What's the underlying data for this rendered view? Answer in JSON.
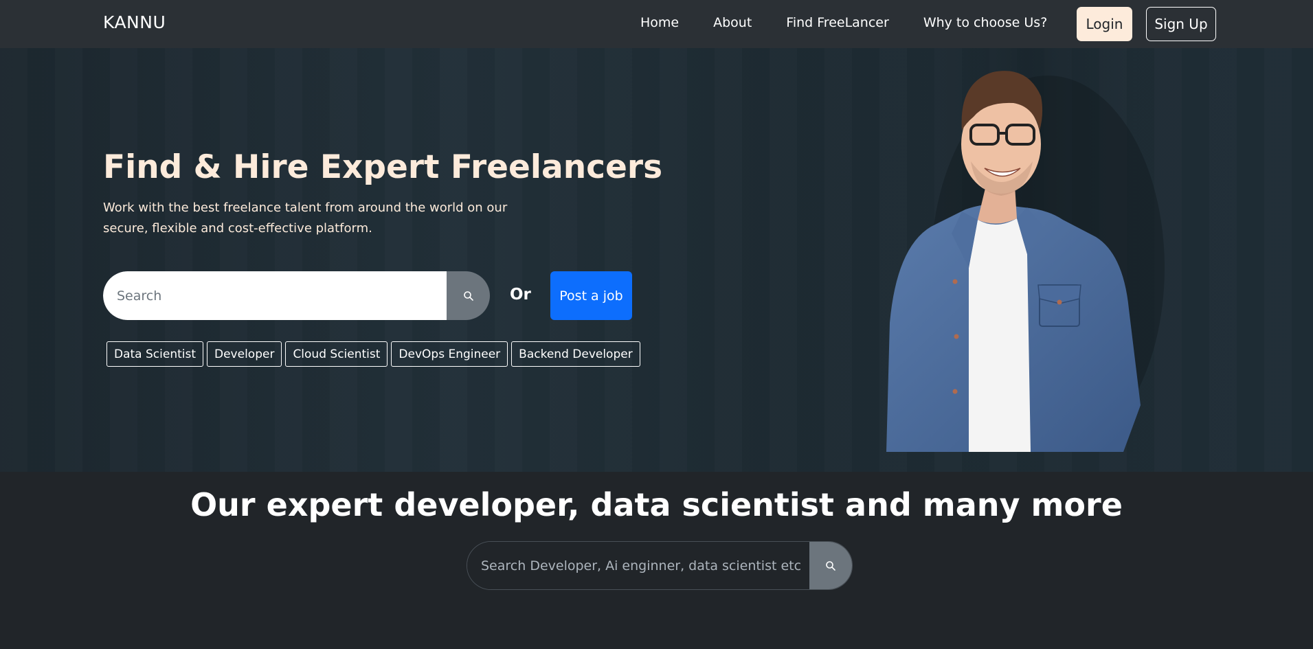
{
  "navbar": {
    "brand": "KANNU",
    "links": [
      "Home",
      "About",
      "Find FreeLancer",
      "Why to choose Us?"
    ],
    "login_label": "Login",
    "signup_label": "Sign Up"
  },
  "hero": {
    "title": "Find & Hire Expert Freelancers",
    "subtitle": "Work with the best freelance talent from around the world on our secure, flexible and cost-effective platform.",
    "search_placeholder": "Search",
    "or_text": "Or",
    "post_job_label": "Post a job",
    "tags": [
      "Data Scientist",
      "Developer",
      "Cloud Scientist",
      "DevOps Engineer",
      "Backend Developer"
    ]
  },
  "section2": {
    "title": "Our expert developer, data scientist and many more",
    "search_placeholder": "Search Developer, Ai enginner, data scientist etc"
  },
  "colors": {
    "accent_blue": "#0d6efd",
    "cream": "#fdebdb",
    "navbar_bg": "#2b3035",
    "page_bg": "#212529"
  },
  "icons": [
    "search-icon"
  ]
}
